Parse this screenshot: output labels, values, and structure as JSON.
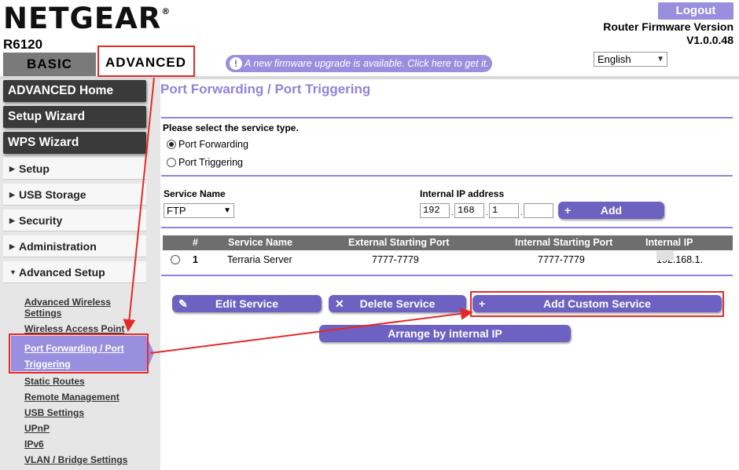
{
  "header": {
    "brand": "NETGEAR",
    "registered": "®",
    "model": "R6120",
    "logout": "Logout",
    "firmware_label": "Router Firmware Version",
    "firmware_version": "V1.0.0.48",
    "language": "English"
  },
  "tabs": {
    "basic": "BASIC",
    "advanced": "ADVANCED"
  },
  "banner": {
    "icon": "exclamation-icon",
    "text": "A new firmware upgrade is available. Click here to get it."
  },
  "sidebar": {
    "primary": [
      "ADVANCED Home",
      "Setup Wizard",
      "WPS Wizard"
    ],
    "sections": [
      "Setup",
      "USB Storage",
      "Security",
      "Administration",
      "Advanced Setup"
    ],
    "subitems": [
      "Advanced Wireless Settings",
      "Wireless Access Point",
      "Port Forwarding / Port Triggering",
      "Static Routes",
      "Remote Management",
      "USB Settings",
      "UPnP",
      "IPv6",
      "VLAN / Bridge Settings"
    ],
    "selected": "Port Forwarding / Port Triggering"
  },
  "main": {
    "title": "Port Forwarding / Port Triggering",
    "service_type_label": "Please select the service type.",
    "option_forwarding": "Port Forwarding",
    "option_triggering": "Port Triggering",
    "selected_option": "Port Forwarding",
    "service_name_label": "Service Name",
    "service_name_value": "FTP",
    "internal_ip_label": "Internal IP address",
    "ip": [
      "192",
      "168",
      "1",
      ""
    ],
    "add_button": "Add"
  },
  "table": {
    "columns": [
      "#",
      "Service Name",
      "External Starting Port",
      "Internal Starting Port",
      "Internal IP address"
    ],
    "rows": [
      {
        "index": "1",
        "service": "Terraria Server",
        "external": "7777-7779",
        "internal": "7777-7779",
        "ip": "192.168.1."
      }
    ]
  },
  "actions": {
    "edit": "Edit Service",
    "delete": "Delete Service",
    "add_custom": "Add Custom Service",
    "arrange": "Arrange by internal IP"
  },
  "colors": {
    "accent": "#9a8ede",
    "button": "#6d62c2",
    "annotation": "#e32a2a"
  }
}
